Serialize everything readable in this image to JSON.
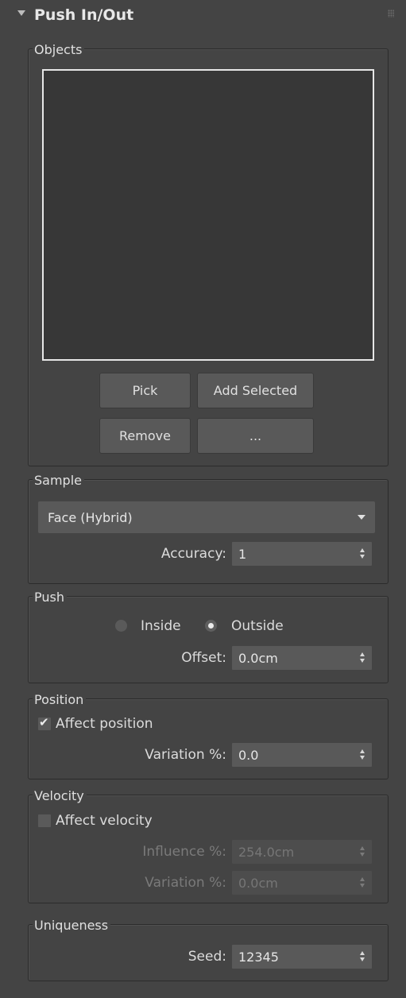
{
  "rollout": {
    "title": "Push In/Out"
  },
  "objects": {
    "label": "Objects",
    "buttons": {
      "pick": "Pick",
      "add_selected": "Add Selected",
      "remove": "Remove",
      "more": "..."
    }
  },
  "sample": {
    "label": "Sample",
    "dropdown_value": "Face (Hybrid)",
    "accuracy_label": "Accuracy:",
    "accuracy_value": "1"
  },
  "push": {
    "label": "Push",
    "inside_label": "Inside",
    "outside_label": "Outside",
    "selected": "Outside",
    "offset_label": "Offset:",
    "offset_value": "0.0cm"
  },
  "position": {
    "label": "Position",
    "affect_label": "Affect position",
    "affect_checked": true,
    "variation_label": "Variation %:",
    "variation_value": "0.0"
  },
  "velocity": {
    "label": "Velocity",
    "affect_label": "Affect velocity",
    "affect_checked": false,
    "influence_label": "Influence %:",
    "influence_value": "254.0cm",
    "variation_label": "Variation %:",
    "variation_value": "0.0cm"
  },
  "uniqueness": {
    "label": "Uniqueness",
    "seed_label": "Seed:",
    "seed_value": "12345"
  }
}
